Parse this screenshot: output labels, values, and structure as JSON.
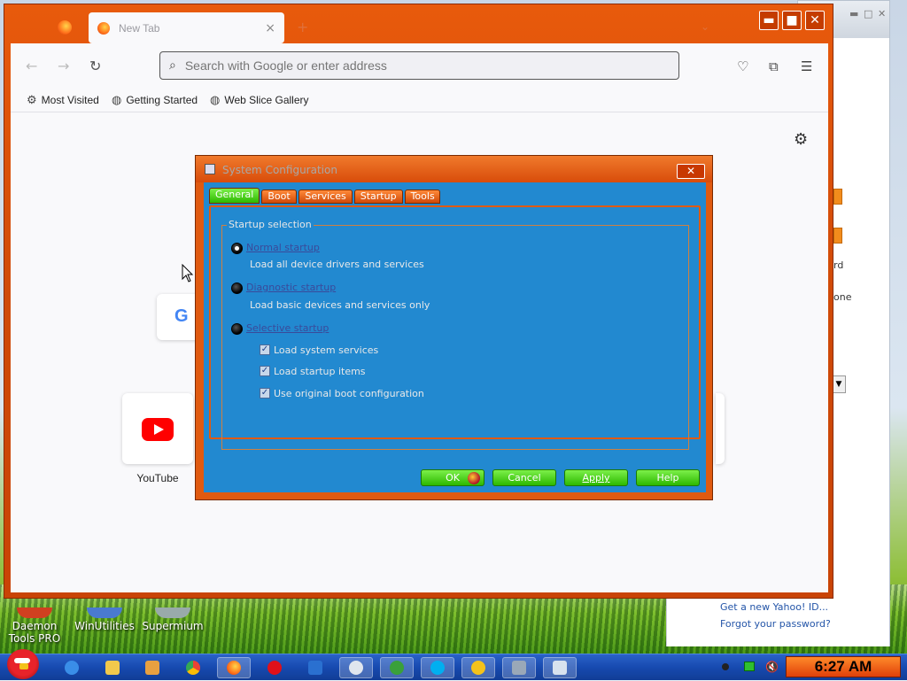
{
  "browser": {
    "tab_title": "New Tab",
    "tab_close": "×",
    "new_tab": "+",
    "window_controls": {
      "minimize": "▬",
      "maximize": "■",
      "close": "✕"
    },
    "nav": {
      "back": "←",
      "forward": "→",
      "reload": "↻"
    },
    "url_placeholder": "Search with Google or enter address",
    "toolbar": {
      "pocket_icon": "pocket-icon",
      "extensions_icon": "extensions-icon",
      "menu_icon": "hamburger-menu-icon"
    },
    "bookmarks": [
      {
        "label": "Most Visited",
        "icon": "gear-icon"
      },
      {
        "label": "Getting Started",
        "icon": "globe-icon"
      },
      {
        "label": "Web Slice Gallery",
        "icon": "globe-icon"
      }
    ],
    "shortcuts": [
      {
        "label": "YouTube",
        "icon": "youtube-icon"
      },
      {
        "label": "",
        "icon": "google-icon"
      }
    ]
  },
  "dialog": {
    "title": "System Configuration",
    "close": "✕",
    "tabs": [
      "General",
      "Boot",
      "Services",
      "Startup",
      "Tools"
    ],
    "active_tab": "General",
    "group_title": "Startup selection",
    "options": [
      {
        "label": "Normal startup",
        "desc": "Load all device drivers and services",
        "checked": true
      },
      {
        "label": "Diagnostic startup",
        "desc": "Load basic devices and services only",
        "checked": false
      },
      {
        "label": "Selective startup",
        "desc": "",
        "checked": false
      }
    ],
    "checkboxes": [
      {
        "label": "Load system services",
        "checked": true
      },
      {
        "label": "Load startup items",
        "checked": true
      },
      {
        "label": "Use original boot configuration",
        "checked": true
      }
    ],
    "buttons": {
      "ok": "OK",
      "cancel": "Cancel",
      "apply": "Apply",
      "help": "Help"
    }
  },
  "background_window": {
    "text_1": "rd",
    "text_2": "one",
    "links": [
      "Get a new Yahoo! ID...",
      "Forgot your password?"
    ]
  },
  "desktop_icons": [
    {
      "label_1": "Daemon",
      "label_2": "Tools PRO"
    },
    {
      "label_1": "WinUtilities",
      "label_2": ""
    },
    {
      "label_1": "Supermium",
      "label_2": ""
    }
  ],
  "taskbar": {
    "clock": "6:27 AM",
    "apps": [
      "internet-explorer-icon",
      "folder-icon",
      "media-player-icon",
      "chrome-icon",
      "firefox-icon",
      "opera-icon",
      "app-icon",
      "chat-icon",
      "utorrent-icon",
      "skype-icon",
      "messenger-icon",
      "monitor-icon",
      "system-config-icon"
    ]
  },
  "colors": {
    "window_frame": "#e05a10",
    "dialog_body": "#2289d0",
    "green_button": "#2db800",
    "taskbar": "#174ab0"
  }
}
